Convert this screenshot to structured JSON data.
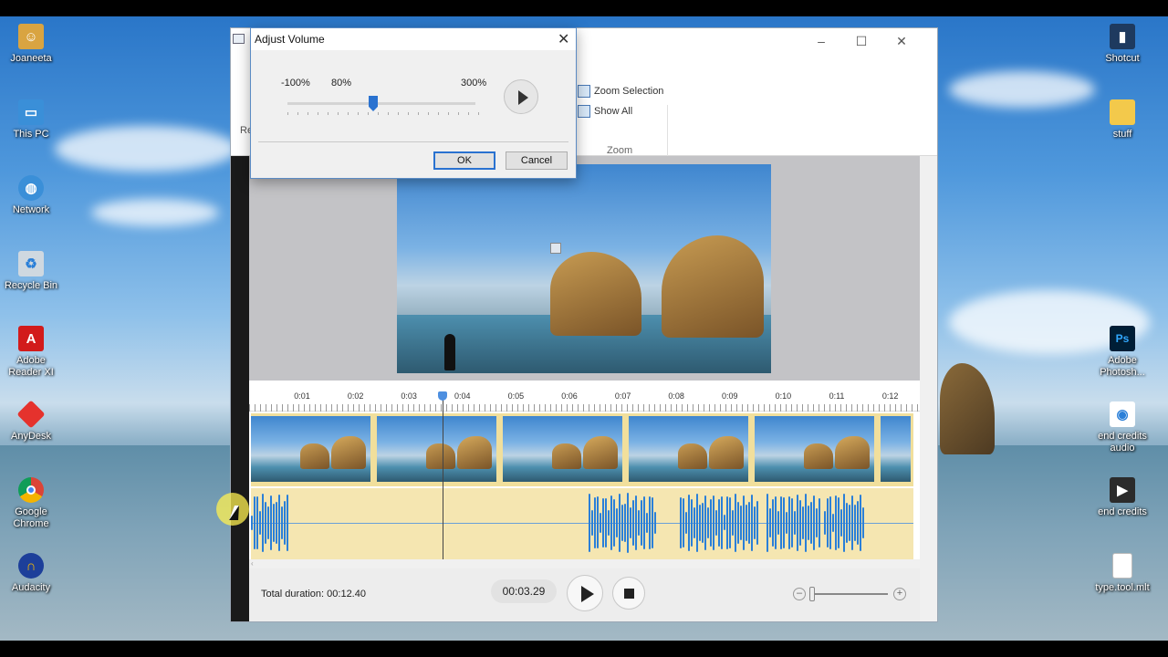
{
  "desktop": {
    "left_icons": [
      {
        "label": "Joaneeta",
        "icon": "user-folder-icon",
        "color": "#d9a441"
      },
      {
        "label": "This PC",
        "icon": "computer-icon",
        "color": "#3a8fd8"
      },
      {
        "label": "Network",
        "icon": "network-icon",
        "color": "#3a8fd8"
      },
      {
        "label": "Recycle Bin",
        "icon": "recycle-bin-icon",
        "color": "#cfd8e0"
      },
      {
        "label": "Adobe Reader XI",
        "icon": "adobe-reader-icon",
        "color": "#d21b1b"
      },
      {
        "label": "AnyDesk",
        "icon": "anydesk-icon",
        "color": "#e5322d"
      },
      {
        "label": "Google Chrome",
        "icon": "chrome-icon",
        "color": "#db4437"
      },
      {
        "label": "Audacity",
        "icon": "audacity-icon",
        "color": "#f2b705"
      }
    ],
    "right_icons": [
      {
        "label": "Shotcut",
        "icon": "shotcut-icon",
        "color": "#1e3a5f"
      },
      {
        "label": "stuff",
        "icon": "folder-icon",
        "color": "#f3c94b"
      },
      {
        "label": "Adobe Photosh...",
        "icon": "photoshop-icon",
        "color": "#001e36"
      },
      {
        "label": "end credits audio",
        "icon": "audio-file-icon",
        "color": "#ffffff"
      },
      {
        "label": "end credits",
        "icon": "video-file-icon",
        "color": "#2b2b2b"
      },
      {
        "label": "type.tool.mlt",
        "icon": "document-icon",
        "color": "#ffffff"
      }
    ]
  },
  "ribbon": {
    "zoom_selection": "Zoom Selection",
    "show_all": "Show All",
    "zoom_group": "Zoom",
    "cut_letter": "Re"
  },
  "dialog": {
    "title": "Adjust Volume",
    "min_label": "-100%",
    "value_label": "80%",
    "max_label": "300%",
    "ok": "OK",
    "cancel": "Cancel",
    "volume_percent": 80
  },
  "timeline": {
    "ticks": [
      "0:01",
      "0:02",
      "0:03",
      "0:04",
      "0:05",
      "0:06",
      "0:07",
      "0:08",
      "0:09",
      "0:10",
      "0:11",
      "0:12"
    ],
    "scroll_arrow": "‹"
  },
  "transport": {
    "total_duration": "Total duration: 00:12.40",
    "current_time": "00:03.29"
  },
  "colors": {
    "accent": "#2a72d0",
    "audio_wave": "#2a7fd8",
    "clip_bg": "#f1df9c"
  }
}
